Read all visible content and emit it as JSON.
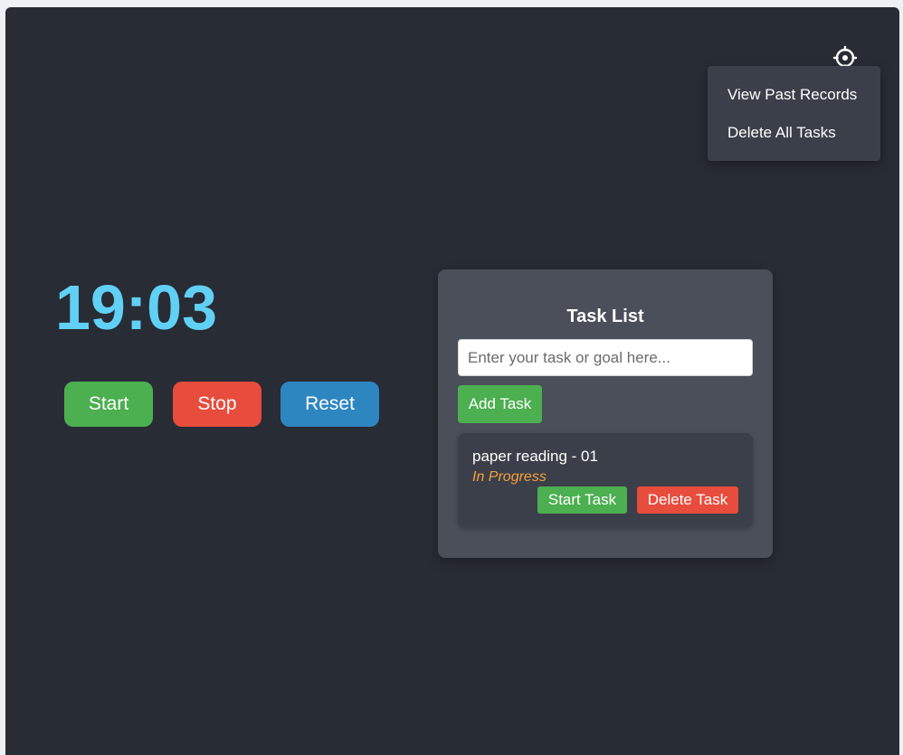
{
  "settings": {
    "icon": "gear-icon",
    "menu": {
      "items": [
        {
          "label": "View Past Records"
        },
        {
          "label": "Delete All Tasks"
        }
      ]
    }
  },
  "timer": {
    "display": "19:03",
    "buttons": {
      "start": "Start",
      "stop": "Stop",
      "reset": "Reset"
    }
  },
  "tasks": {
    "title": "Task List",
    "input_placeholder": "Enter your task or goal here...",
    "input_value": "",
    "add_label": "Add Task",
    "items": [
      {
        "name": "paper reading - 01",
        "status": "In Progress",
        "start_label": "Start Task",
        "delete_label": "Delete Task"
      }
    ]
  },
  "colors": {
    "background": "#282c35",
    "timer_text": "#61d0f5",
    "start": "#4caf50",
    "stop": "#e74c3c",
    "reset": "#2e86c1",
    "status_in_progress": "#f5a03a"
  }
}
